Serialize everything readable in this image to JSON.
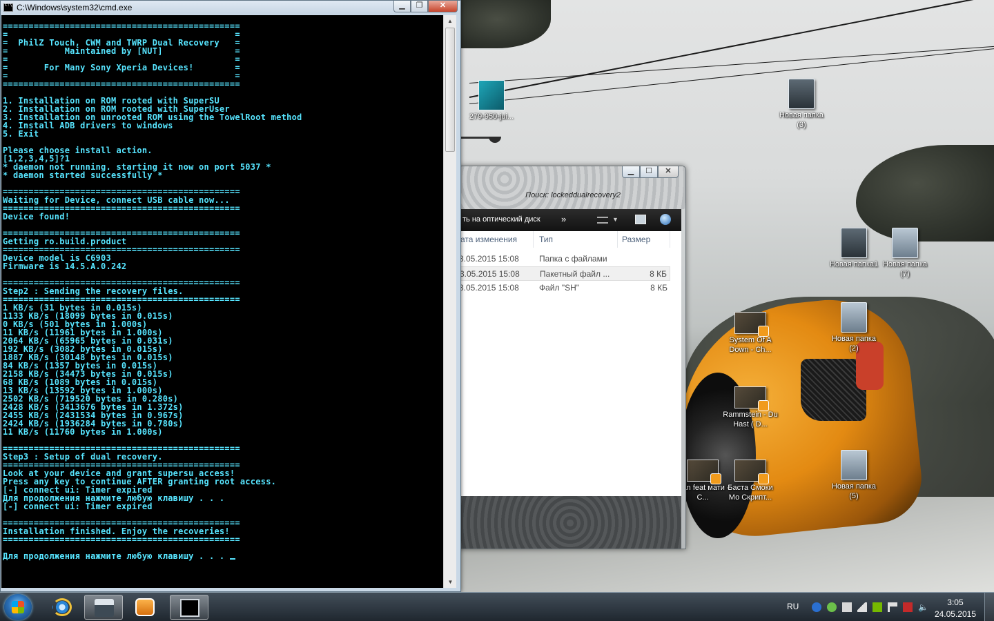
{
  "desktop": {
    "icons": [
      {
        "id": "img-279",
        "label": "279-950-jui...",
        "kind": "image"
      },
      {
        "id": "folder-3",
        "label": "Новая папка (3)",
        "kind": "folder-dark"
      },
      {
        "id": "folder-1",
        "label": "Новая папка1",
        "kind": "folder-dark"
      },
      {
        "id": "folder-7",
        "label": "Новая папка (7)",
        "kind": "folder"
      },
      {
        "id": "video-soad",
        "label": "System Of A Down - Ch...",
        "kind": "video"
      },
      {
        "id": "folder-2",
        "label": "Новая папка (2)",
        "kind": "folder"
      },
      {
        "id": "video-rammstein",
        "label": "Rammstein - Du Hast ( D...",
        "kind": "video"
      },
      {
        "id": "video-atan",
        "label": "atan feat мати - С...",
        "kind": "video"
      },
      {
        "id": "video-basta",
        "label": "Баста Смоки Мо Скрипт...",
        "kind": "video"
      },
      {
        "id": "folder-5",
        "label": "Новая папка (5)",
        "kind": "folder"
      }
    ]
  },
  "cmd": {
    "title": "C:\\Windows\\system32\\cmd.exe",
    "lines": [
      "==============================================",
      "=                                            =",
      "=  PhilZ Touch, CWM and TWRP Dual Recovery   =",
      "=           Maintained by [NUT]              =",
      "=                                            =",
      "=       For Many Sony Xperia Devices!        =",
      "=                                            =",
      "==============================================",
      "",
      "1. Installation on ROM rooted with SuperSU",
      "2. Installation on ROM rooted with SuperUser",
      "3. Installation on unrooted ROM using the TowelRoot method",
      "4. Install ADB drivers to windows",
      "5. Exit",
      "",
      "Please choose install action.",
      "[1,2,3,4,5]?1",
      "* daemon not running. starting it now on port 5037 *",
      "* daemon started successfully *",
      "",
      "==============================================",
      "Waiting for Device, connect USB cable now...",
      "==============================================",
      "Device found!",
      "",
      "==============================================",
      "Getting ro.build.product",
      "==============================================",
      "Device model is C6903",
      "Firmware is 14.5.A.0.242",
      "",
      "==============================================",
      "Step2 : Sending the recovery files.",
      "==============================================",
      "1 KB/s (31 bytes in 0.015s)",
      "1133 KB/s (18099 bytes in 0.015s)",
      "0 KB/s (501 bytes in 1.000s)",
      "11 KB/s (11961 bytes in 1.000s)",
      "2064 KB/s (65965 bytes in 0.031s)",
      "192 KB/s (3082 bytes in 0.015s)",
      "1887 KB/s (30148 bytes in 0.015s)",
      "84 KB/s (1357 bytes in 0.015s)",
      "2158 KB/s (34473 bytes in 0.015s)",
      "68 KB/s (1089 bytes in 0.015s)",
      "13 KB/s (13592 bytes in 1.000s)",
      "2502 KB/s (719520 bytes in 0.280s)",
      "2428 KB/s (3413676 bytes in 1.372s)",
      "2455 KB/s (2431534 bytes in 0.967s)",
      "2424 KB/s (1936284 bytes in 0.780s)",
      "11 KB/s (11760 bytes in 1.000s)",
      "",
      "==============================================",
      "Step3 : Setup of dual recovery.",
      "==============================================",
      "Look at your device and grant supersu access!",
      "Press any key to continue AFTER granting root access.",
      "[-] connect ui: Timer expired",
      "Для продолжения нажмите любую клавишу . . .",
      "[-] connect ui: Timer expired",
      "",
      "==============================================",
      "Installation finished. Enjoy the recoveries!",
      "==============================================",
      "",
      "Для продолжения нажмите любую клавишу . . . "
    ]
  },
  "explorer": {
    "search_title": "Поиск: lockeddualrecovery2",
    "toolbar": {
      "burn_label": "ть на оптический диск",
      "more_label": "»"
    },
    "columns": {
      "date": "ата изменения",
      "type": "Тип",
      "size": "Размер"
    },
    "rows": [
      {
        "date": "3.05.2015 15:08",
        "type": "Папка с файлами",
        "size": ""
      },
      {
        "date": "3.05.2015 15:08",
        "type": "Пакетный файл ...",
        "size": "8 КБ"
      },
      {
        "date": "3.05.2015 15:08",
        "type": "Файл \"SH\"",
        "size": "8 КБ"
      }
    ]
  },
  "taskbar": {
    "pinned": [
      "internet-explorer-icon",
      "scanner-icon",
      "media-player-icon",
      "cmd-icon"
    ],
    "tray": {
      "lang": "RU"
    },
    "clock": {
      "time": "3:05",
      "date": "24.05.2015"
    }
  }
}
